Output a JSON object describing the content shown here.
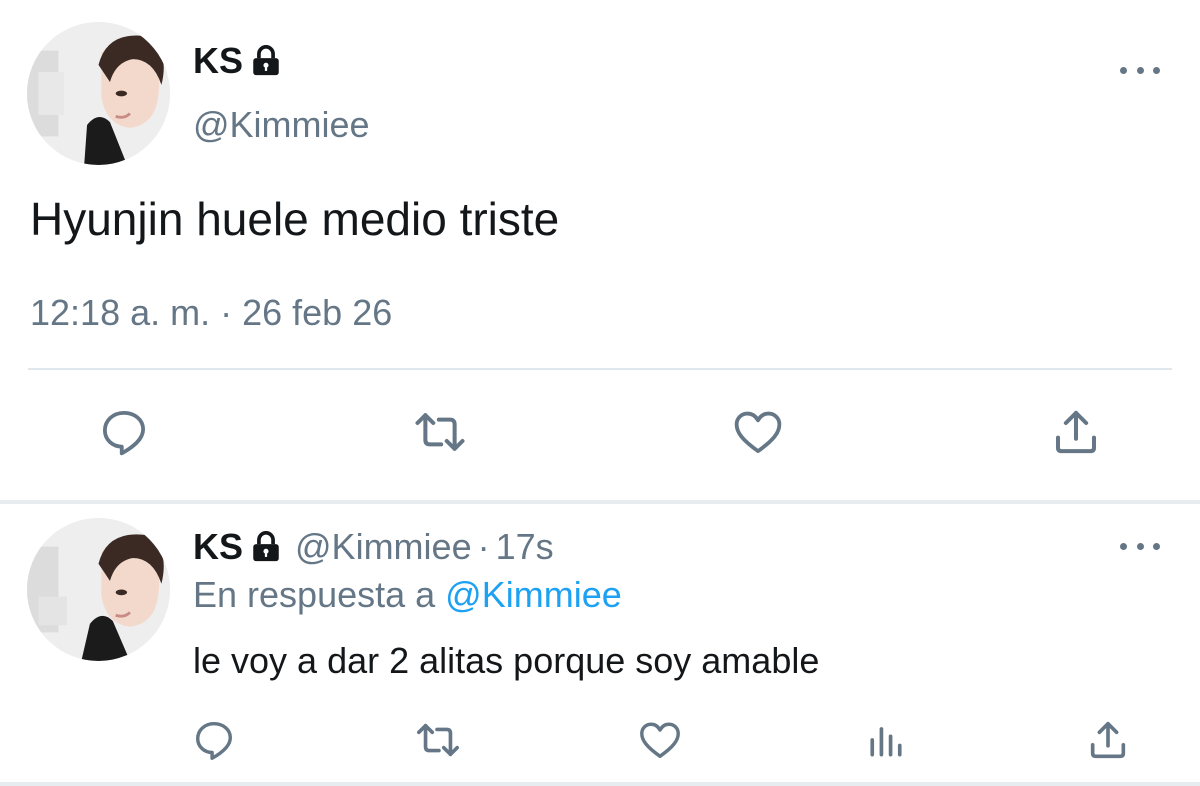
{
  "colors": {
    "text_primary": "#14171a",
    "text_secondary": "#657786",
    "mention": "#1da1f2",
    "divider": "#e1e8ed"
  },
  "main_tweet": {
    "avatar_icon": "profile-photo",
    "display_name": "KS",
    "protected_icon": "lock-icon",
    "handle": "@Kimmiee",
    "text": "Hyunjin huele medio triste",
    "timestamp": "12:18 a. m. · 26 feb 26",
    "more_icon": "more-options-icon",
    "actions": [
      "reply-icon",
      "retweet-icon",
      "like-icon",
      "share-icon"
    ]
  },
  "reply_tweet": {
    "avatar_icon": "profile-photo",
    "display_name": "KS",
    "protected_icon": "lock-icon",
    "handle": "@Kimmiee",
    "separator": "·",
    "time_ago": "17s",
    "replying_to_prefix": "En respuesta a",
    "replying_to_mention": "@Kimmiee",
    "text": "le voy a dar 2 alitas porque soy amable",
    "more_icon": "more-options-icon",
    "actions": [
      "reply-icon",
      "retweet-icon",
      "like-icon",
      "analytics-icon",
      "share-icon"
    ]
  }
}
